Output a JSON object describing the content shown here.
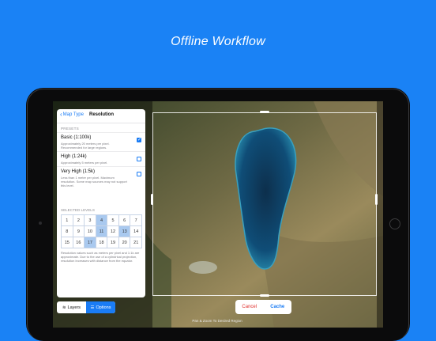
{
  "headline": "Offline Workflow",
  "panel": {
    "back_label": "Map Type",
    "title": "Resolution",
    "presets_header": "PRESETS",
    "options": [
      {
        "title": "Basic (1:100k)",
        "desc": "Approximately 20 meters per pixel. Recommended for large regions.",
        "checked": true
      },
      {
        "title": "High (1:24k)",
        "desc": "Approximately 5 meters per pixel.",
        "checked": false
      },
      {
        "title": "Very High (1:5k)",
        "desc": "Less than 1 meter per pixel. Maximum resolution. Some map sources may not support this level.",
        "checked": false
      }
    ],
    "levels_header": "SELECTED LEVELS",
    "levels": [
      1,
      2,
      3,
      4,
      5,
      6,
      7,
      8,
      9,
      10,
      11,
      12,
      13,
      14,
      15,
      16,
      17,
      18,
      19,
      20,
      21
    ],
    "selected_levels": [
      4,
      11,
      13,
      17
    ],
    "note": "Resolution values such as meters per pixel and 1:1k are approximate. Due to the use of a cylindrical projection, resolution increases with distance from the equator."
  },
  "segment": {
    "layers_label": "Layers",
    "options_label": "Options",
    "selected": "Options"
  },
  "actions": {
    "cancel_label": "Cancel",
    "cache_label": "Cache"
  },
  "hint": "Pan & Zoom To Desired Region",
  "colors": {
    "background": "#1a82f5",
    "accent": "#1a7cf5",
    "cancel": "#e0302d",
    "selected_cell": "#a9c9ef"
  }
}
